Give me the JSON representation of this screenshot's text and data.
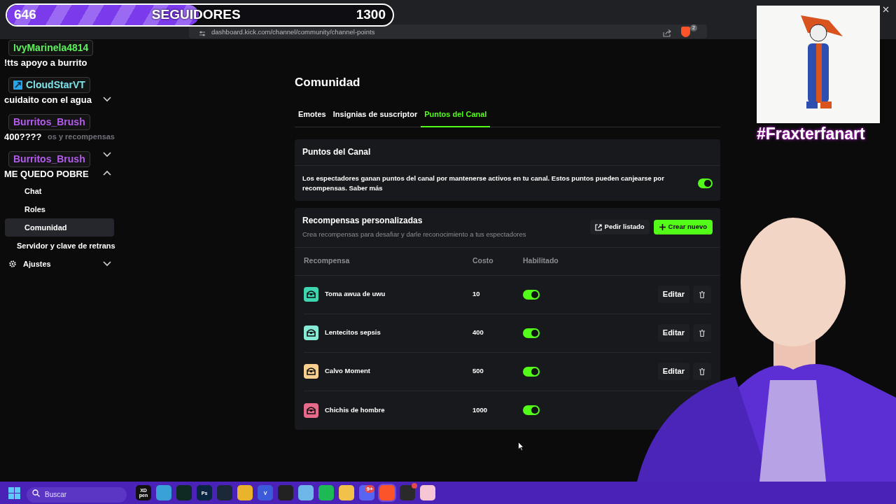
{
  "browser": {
    "url": "dashboard.kick.com/channel/community/channel-points",
    "shield_badge": "2"
  },
  "follower_goal": {
    "current": "646",
    "label": "SEGUIDORES",
    "target": "1300",
    "level": 0.497
  },
  "chat": [
    {
      "user": "IvyMarinela4814",
      "color": "#5cf05c",
      "kind": "plain",
      "message": "!tts apoyo a burrito"
    },
    {
      "user": "CloudStarVT",
      "color": "#7de3e8",
      "kind": "badge",
      "message": "cuidaito con el agua"
    },
    {
      "user": "Burritos_Brush",
      "color": "#b45cf0",
      "kind": "plain",
      "message": "400????"
    },
    {
      "user": "Burritos_Brush",
      "color": "#b45cf0",
      "kind": "plain",
      "message": "ME QUEDO POBRE"
    }
  ],
  "sidebar": {
    "sections": [
      {
        "expanded": false
      },
      {
        "label": "os y recompensas"
      },
      {
        "expanded": false
      },
      {
        "expanded": true,
        "children": [
          {
            "label": "Chat",
            "selected": false
          },
          {
            "label": "Roles",
            "selected": false
          },
          {
            "label": "Comunidad",
            "selected": true
          }
        ]
      },
      {
        "label": "Servidor y clave de retrans"
      },
      {
        "label": "Ajustes",
        "kind": "settings",
        "expanded": false
      }
    ]
  },
  "page": {
    "title": "Comunidad",
    "tabs": [
      {
        "label": "Emotes",
        "selected": false
      },
      {
        "label": "Insignias de suscriptor",
        "selected": false
      },
      {
        "label": "Puntos del Canal",
        "selected": true
      }
    ],
    "points_card": {
      "title": "Puntos del Canal",
      "description": "Los espectadores ganan puntos del canal por mantenerse activos en tu canal. Estos puntos pueden canjearse por recompensas. Saber más",
      "on": true
    },
    "rewards": {
      "title": "Recompensas personalizadas",
      "subtitle": "Crea recompensas para desafiar y darle reconocimiento a tus espectadores",
      "buttons": [
        {
          "label": "Pedir listado",
          "kind": "secondary"
        },
        {
          "label": "Crear nuevo",
          "kind": "primary"
        }
      ],
      "columns": [
        "Recompensa",
        "Costo",
        "Habilitado"
      ],
      "rows": [
        {
          "name": "Toma awua de uwu",
          "cost": "10",
          "color": "#3ed6b0",
          "on": true,
          "edit": "Editar"
        },
        {
          "name": "Lentecitos sepsis",
          "cost": "400",
          "color": "#86ead6",
          "on": true,
          "edit": "Editar"
        },
        {
          "name": "Calvo Moment",
          "cost": "500",
          "color": "#f8cf8e",
          "on": true,
          "edit": "Editar"
        },
        {
          "name": "Chichis de hombre",
          "cost": "1000",
          "color": "#e86a8a",
          "on": true
        }
      ]
    }
  },
  "fanart": {
    "caption": "#Fraxterfanart"
  },
  "taskbar": {
    "search_placeholder": "Buscar",
    "apps": [
      {
        "color": "#111111",
        "label": "XD pen"
      },
      {
        "color": "#3aa0d8"
      },
      {
        "color": "#0e2a22"
      },
      {
        "color": "#0a2540",
        "label": "Ps"
      },
      {
        "color": "#1b2838"
      },
      {
        "color": "#e9b32c"
      },
      {
        "color": "#3b5bdb",
        "label": "V"
      },
      {
        "color": "#222222"
      },
      {
        "color": "#6fb7e8"
      },
      {
        "color": "#1db954"
      },
      {
        "color": "#f2c14a"
      },
      {
        "color": "#5865f2",
        "badge": "9+"
      },
      {
        "color": "#fb542b",
        "active": true
      },
      {
        "color": "#2a2a2a",
        "alert": true
      },
      {
        "color": "#f7c6d4"
      }
    ]
  }
}
